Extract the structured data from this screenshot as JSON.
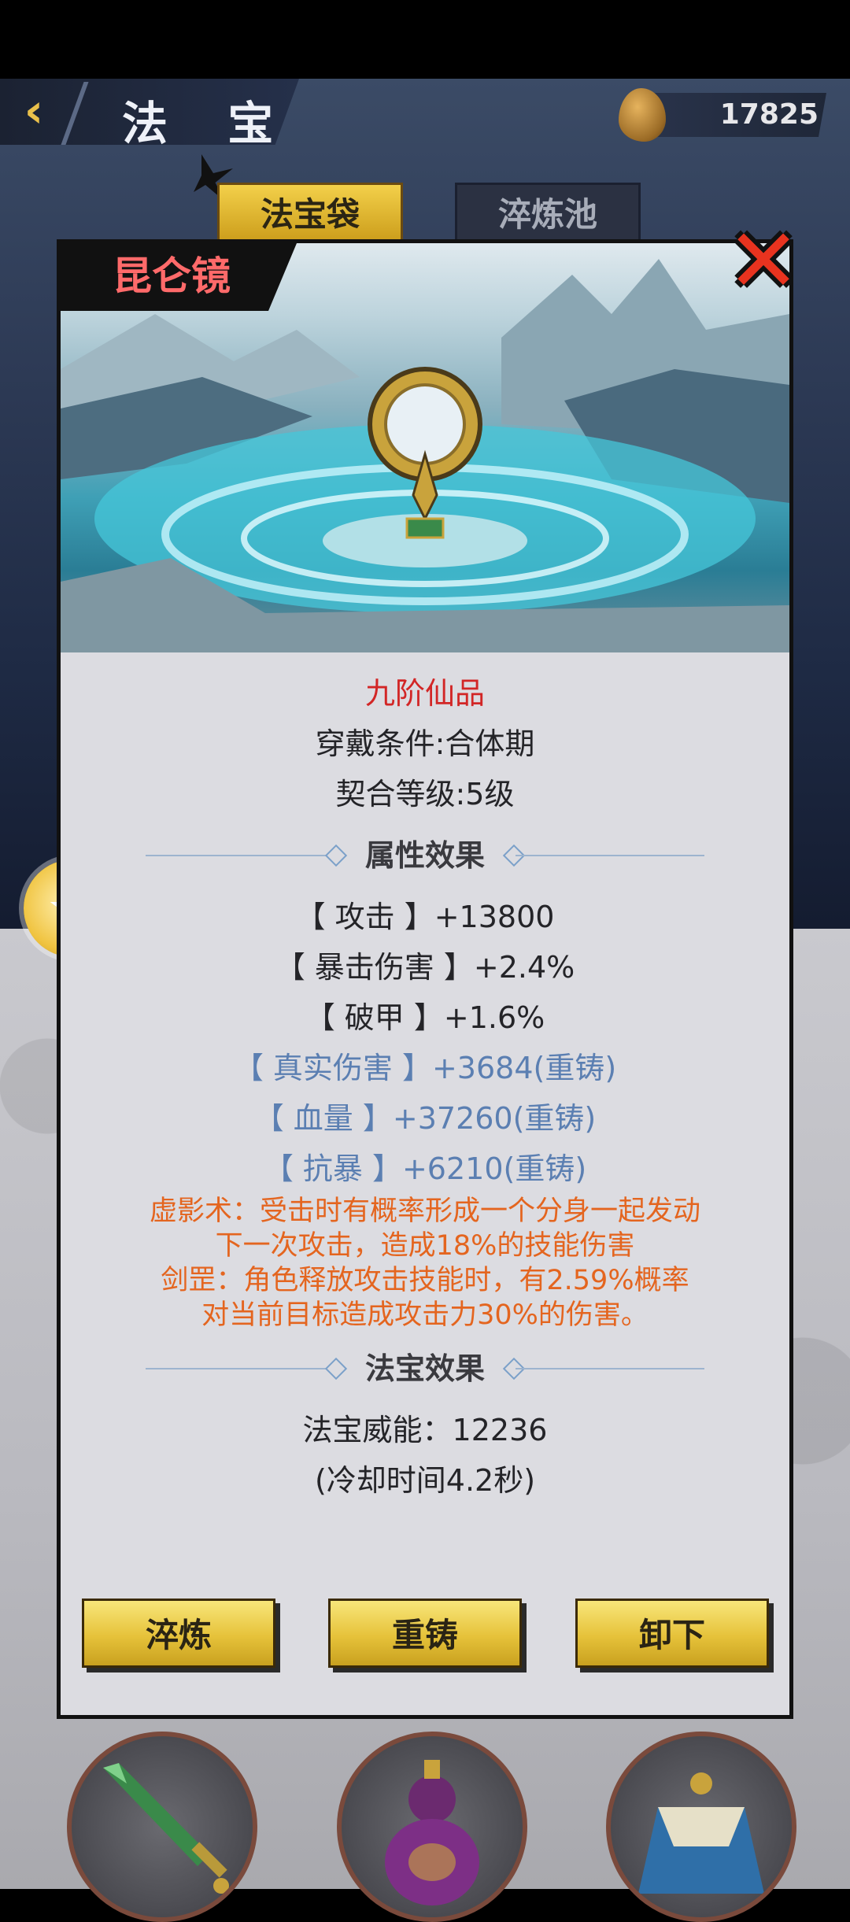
{
  "header": {
    "title": "法 宝",
    "currency_value": "17825"
  },
  "tabs": [
    {
      "label": "法宝袋"
    },
    {
      "label": "淬炼池"
    }
  ],
  "modal": {
    "name": "昆仑镜",
    "grade": "九阶仙品",
    "requirement": "穿戴条件:合体期",
    "bond_level": "契合等级:5级",
    "attributes_title": "属性效果",
    "stats": [
      {
        "text": "【 攻击 】+13800",
        "reforged": false
      },
      {
        "text": "【 暴击伤害 】+2.4%",
        "reforged": false
      },
      {
        "text": "【 破甲 】+1.6%",
        "reforged": false
      },
      {
        "text": "【 真实伤害 】+3684(重铸)",
        "reforged": true
      },
      {
        "text": "【 血量 】+37260(重铸)",
        "reforged": true
      },
      {
        "text": "【 抗暴 】+6210(重铸)",
        "reforged": true
      }
    ],
    "skills": [
      "虚影术：受击时有概率形成一个分身一起发动下一次攻击，造成18%的技能伤害",
      "剑罡：角色释放攻击技能时，有2.59%概率对当前目标造成攻击力30%的伤害。"
    ],
    "effect_title": "法宝效果",
    "power": "法宝威能：12236",
    "cooldown": "(冷却时间4.2秒)",
    "buttons": {
      "refine": "淬炼",
      "reforge": "重铸",
      "unequip": "卸下"
    }
  },
  "colors": {
    "grade": "#d22626",
    "reforged_stat": "#5b7fb2",
    "skill_text": "#e4651f",
    "button_gold": "#e6c23a",
    "close_red": "#e8331f"
  },
  "icons": [
    "back-icon",
    "spirit-stone-icon",
    "close-icon",
    "star-badge-icon",
    "sword-icon",
    "gourd-icon",
    "fan-icon"
  ]
}
